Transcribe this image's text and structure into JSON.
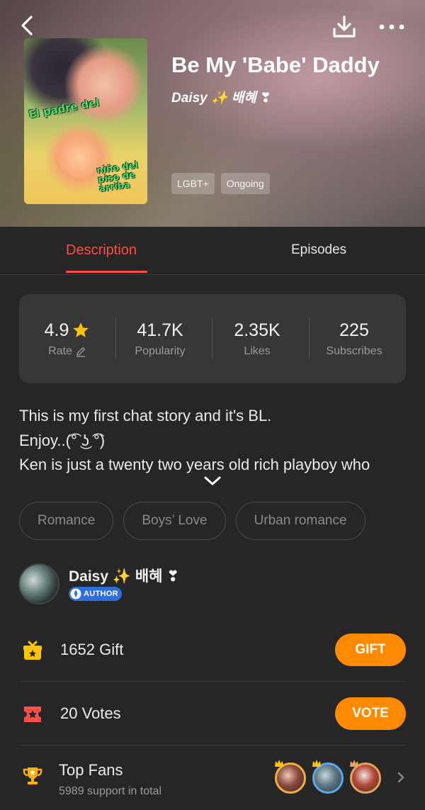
{
  "header": {
    "title": "Be My 'Babe' Daddy",
    "author_line": "Daisy ✨ 배혜 ❣",
    "tags": [
      "LGBT+",
      "Ongoing"
    ],
    "cover": {
      "text_top": "El padre del",
      "text_bottom": "niño del piso de arriba"
    }
  },
  "tabs": [
    {
      "label": "Description",
      "active": true
    },
    {
      "label": "Episodes",
      "active": false
    }
  ],
  "stats": [
    {
      "value": "4.9",
      "label": "Rate",
      "icon": "star-icon"
    },
    {
      "value": "41.7K",
      "label": "Popularity"
    },
    {
      "value": "2.35K",
      "label": "Likes"
    },
    {
      "value": "225",
      "label": "Subscribes"
    }
  ],
  "description": [
    "This is my first chat story and it's BL.",
    "Enjoy..(͡° ͜ʖ ͡°)",
    "Ken is just a twenty two years old rich playboy who"
  ],
  "genres": [
    "Romance",
    "Boys’ Love",
    "Urban romance"
  ],
  "author": {
    "name": "Daisy ✨ 배혜 ❣",
    "badge": "AUTHOR"
  },
  "gift": {
    "count": "1652",
    "label": "Gift",
    "button": "GIFT"
  },
  "vote": {
    "count": "20",
    "label": "Votes",
    "button": "VOTE"
  },
  "fans": {
    "title": "Top Fans",
    "subtitle": "5989 support in total"
  },
  "colors": {
    "accent_red": "#ff4d47",
    "button_orange": "#ff8a00",
    "background": "#262626",
    "card": "#373737",
    "star": "#ffc400"
  }
}
